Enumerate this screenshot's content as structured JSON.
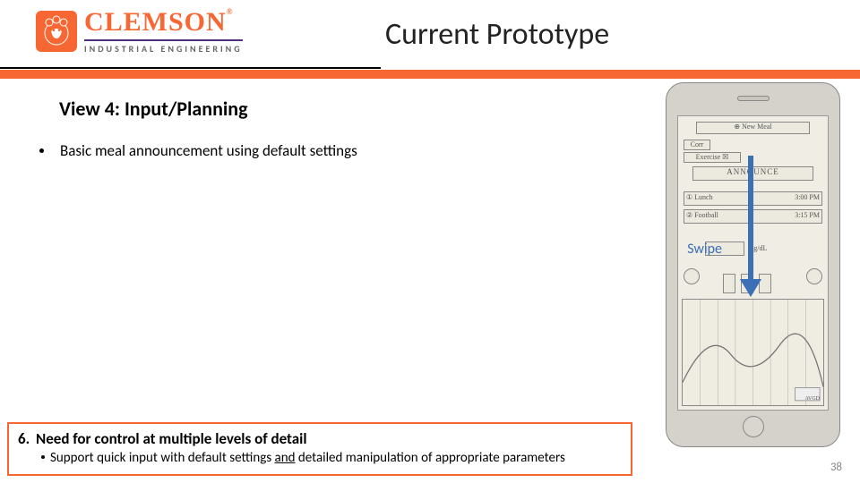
{
  "header": {
    "logo_main": "CLEMSON",
    "logo_reg": "®",
    "logo_sub": "INDUSTRIAL ENGINEERING",
    "title": "Current Prototype"
  },
  "body": {
    "view_title": "View 4: Input/Planning",
    "bullet1": "Basic meal announcement using default settings",
    "swipe_label": "Swipe"
  },
  "sketch": {
    "new_meal": "⊕ New Meal",
    "corr": "Corr",
    "exercise": "Exercise ☒",
    "announce": "ANNOUNCE",
    "row1_left": "① Lunch",
    "row1_right": "3:00 PM",
    "row2_left": "② Football",
    "row2_right": "3:15 PM",
    "unit": "mg/dL",
    "avgd": "AVGD"
  },
  "need": {
    "num": "6.",
    "title": "Need for control at multiple levels of detail",
    "sub_pre": "Support quick input with default settings ",
    "sub_and": "and",
    "sub_post": " detailed manipulation of appropriate parameters"
  },
  "page_number": "38"
}
